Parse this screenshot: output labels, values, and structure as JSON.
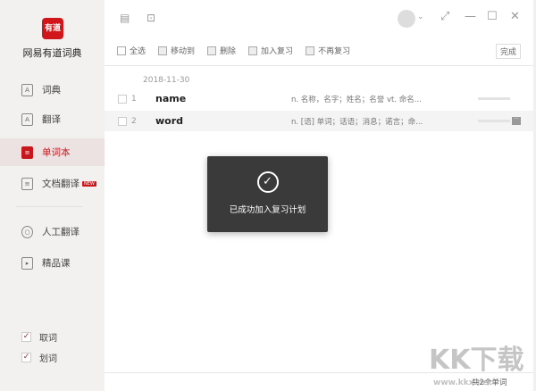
{
  "app": {
    "logo_text": "有道",
    "name": "网易有道词典"
  },
  "sidebar": {
    "items": [
      {
        "label": "词典",
        "icon": "A"
      },
      {
        "label": "翻译",
        "icon": "A"
      },
      {
        "label": "单词本",
        "icon": "≡"
      },
      {
        "label": "文档翻译",
        "icon": "≡",
        "badge": "NEW"
      },
      {
        "label": "人工翻译",
        "icon": "○"
      },
      {
        "label": "精品课",
        "icon": "▸"
      }
    ],
    "checks": [
      {
        "label": "取词",
        "checked": true
      },
      {
        "label": "划词",
        "checked": true
      }
    ]
  },
  "toolbar": {
    "actions": [
      "全选",
      "移动到",
      "删除",
      "加入复习",
      "不再复习"
    ],
    "done": "完成"
  },
  "window": {
    "minimize": "—",
    "maximize": "☐",
    "close": "✕",
    "restore": "⤢",
    "dropdown": "⌄"
  },
  "wordlist": {
    "date": "2018-11-30",
    "rows": [
      {
        "num": "1",
        "word": "name",
        "def": "n. 名称，名字；姓名；名誉  vt. 命名..."
      },
      {
        "num": "2",
        "word": "word",
        "def": "n. [语] 单词；话语；消息；诺言；命..."
      }
    ]
  },
  "toast": {
    "message": "已成功加入复习计划",
    "icon": "✓"
  },
  "footer": {
    "count": "共2个单词"
  },
  "watermark": {
    "main": "KK下载",
    "url": "www.kkx.net"
  }
}
